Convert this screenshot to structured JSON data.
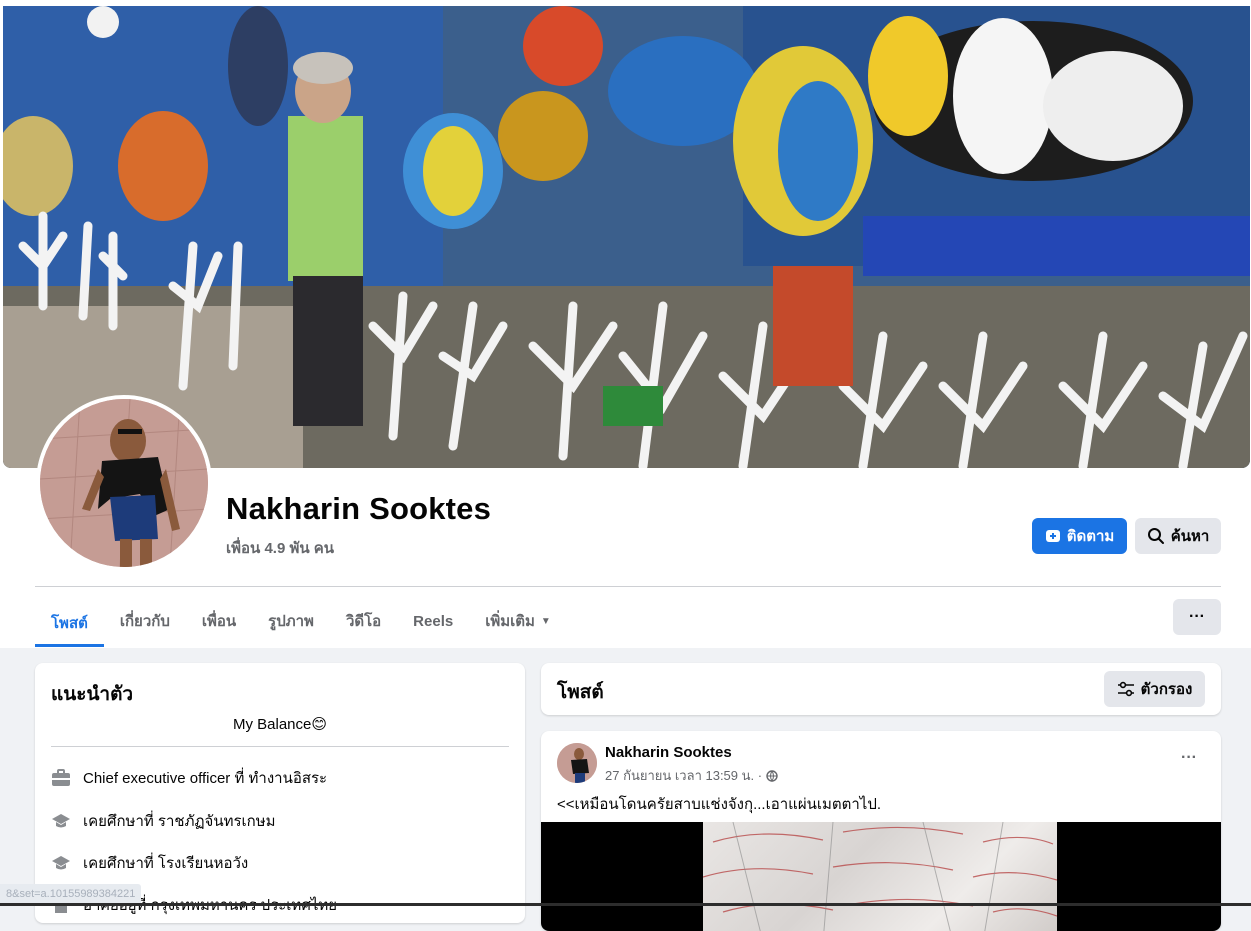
{
  "profile": {
    "name": "Nakharin Sooktes",
    "friends": "เพื่อน 4.9 พัน คน",
    "follow_label": "ติดตาม",
    "search_label": "ค้นหา"
  },
  "tabs": [
    {
      "label": "โพสต์",
      "active": true
    },
    {
      "label": "เกี่ยวกับ",
      "active": false
    },
    {
      "label": "เพื่อน",
      "active": false
    },
    {
      "label": "รูปภาพ",
      "active": false
    },
    {
      "label": "วิดีโอ",
      "active": false
    },
    {
      "label": "Reels",
      "active": false
    },
    {
      "label": "เพิ่มเติม",
      "active": false
    }
  ],
  "more_dots": "···",
  "intro": {
    "title": "แนะนำตัว",
    "bio": "My Balance😊",
    "items": [
      {
        "icon": "briefcase-icon",
        "text": "Chief executive officer ที่ ทำงานอิสระ"
      },
      {
        "icon": "graduation-cap-icon",
        "text": "เคยศึกษาที่ ราชภัฏจันทรเกษม"
      },
      {
        "icon": "graduation-cap-icon",
        "text": "เคยศึกษาที่ โรงเรียนหอวัง"
      },
      {
        "icon": "house-icon",
        "text": "อาศัยอยู่ที่ กรุงเทพมหานคร ประเทศไทย"
      }
    ]
  },
  "posts_header": {
    "title": "โพสต์",
    "filter_label": "ตัวกรอง"
  },
  "post": {
    "author": "Nakharin Sooktes",
    "timestamp": "27 กันยายน เวลา 13:59 น. ·",
    "privacy_icon": "globe-icon",
    "text": "<<เหมือนโดนครัยสาบแช่งจังกุ...เอาแผ่นเมตตาไป.",
    "more": "···"
  },
  "status_bar": {
    "url": "8&set=a.10155989384221"
  },
  "colors": {
    "accent": "#1b74e4",
    "background": "#f0f2f5",
    "secondary_text": "#65676b"
  }
}
